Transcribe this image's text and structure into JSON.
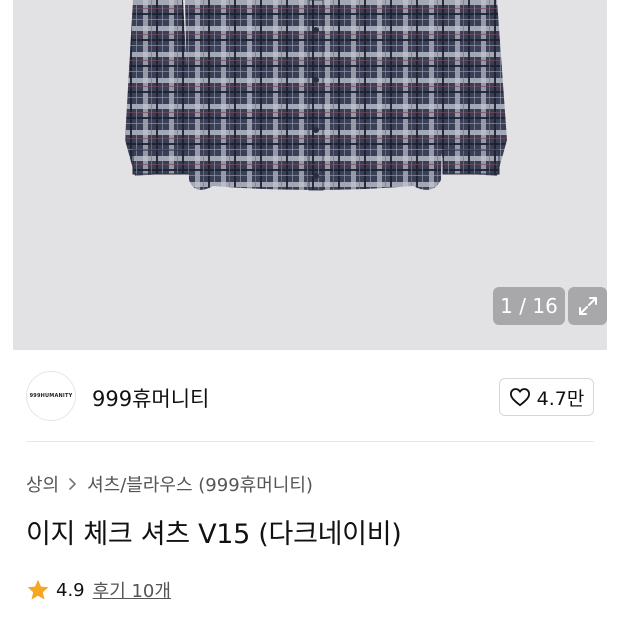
{
  "gallery": {
    "image_alt": "이지 체크 셔츠 V15 (다크네이비)",
    "counter": "1 / 16",
    "expand_icon": "expand-arrows-icon"
  },
  "brand": {
    "logo_text": "999HUMANITY",
    "name": "999휴머니티",
    "like_icon": "heart-outline-icon",
    "like_count": "4.7만"
  },
  "breadcrumb": {
    "items": [
      "상의",
      "셔츠/블라우스 (999휴머니티)"
    ],
    "separator_icon": "chevron-right-icon"
  },
  "product": {
    "title": "이지 체크 셔츠 V15 (다크네이비)"
  },
  "rating": {
    "star_icon": "star-icon",
    "value": "4.9",
    "review_label": "후기 10개"
  },
  "colors": {
    "star": "#F5A623",
    "gallery_bg": "#E2E2E4"
  }
}
